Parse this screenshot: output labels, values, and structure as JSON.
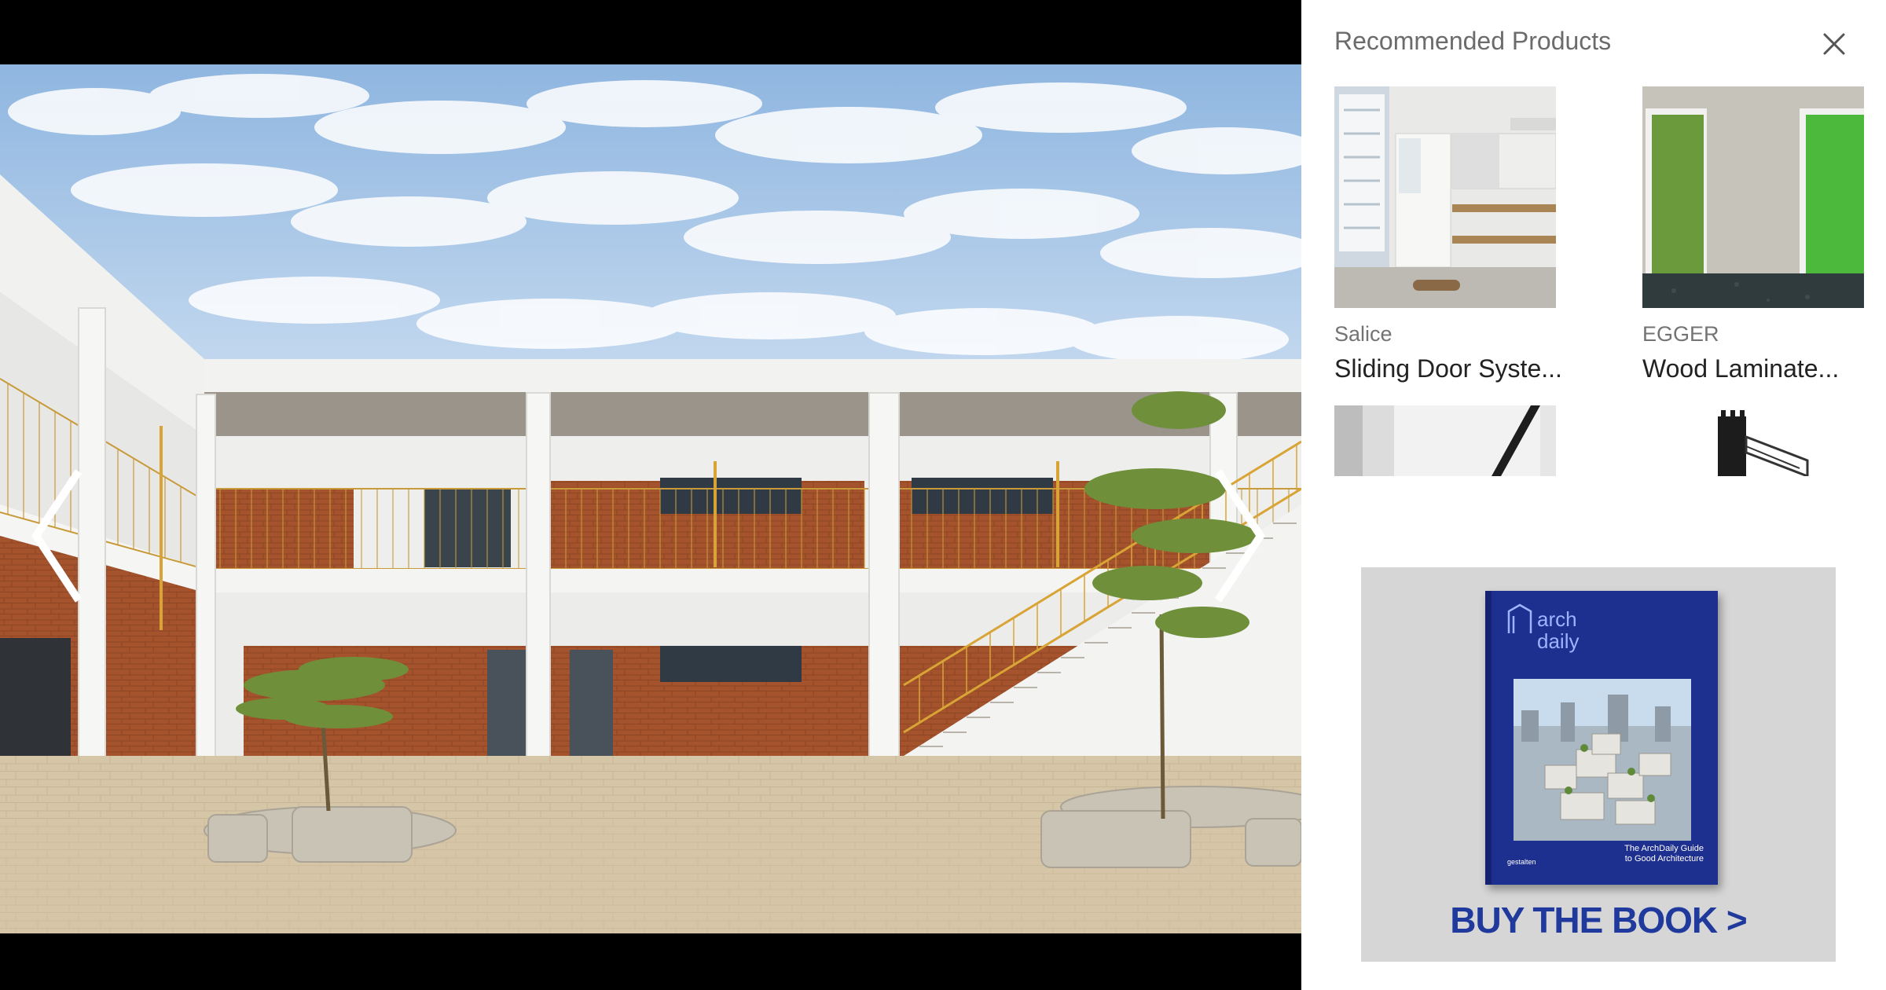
{
  "panel": {
    "title": "Recommended Products",
    "close_icon": "close-icon"
  },
  "products": [
    {
      "brand": "Salice",
      "name": "Sliding Door Syste..."
    },
    {
      "brand": "EGGER",
      "name": "Wood Laminate..."
    }
  ],
  "gallery": {
    "prev_icon": "chevron-left-icon",
    "next_icon": "chevron-right-icon"
  },
  "ad": {
    "book_brand_line1": "arch",
    "book_brand_line2": "daily",
    "book_caption_line1": "The ArchDaily Guide",
    "book_caption_line2": "to Good Architecture",
    "book_publisher": "gestalten",
    "cta": "BUY THE BOOK >"
  },
  "colors": {
    "viewer_background": "#000000",
    "panel_background": "#ffffff",
    "ad_cta": "#1f3a9c",
    "book_cover": "#1d2f8f"
  }
}
